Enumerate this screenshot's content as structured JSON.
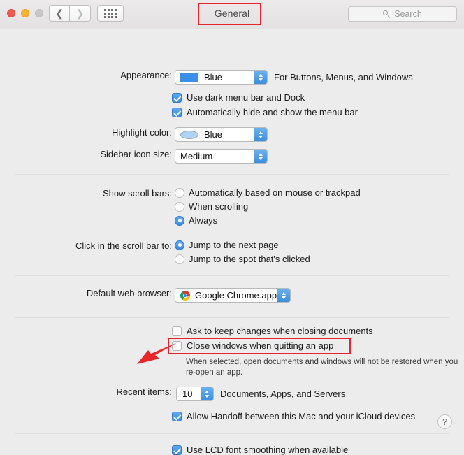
{
  "window": {
    "title": "General",
    "traffic_lights": [
      "close",
      "minimize",
      "zoom"
    ]
  },
  "toolbar": {
    "back_icon": "chevron-left-icon",
    "forward_icon": "chevron-right-icon",
    "grid_icon": "show-all-grid-icon",
    "search": {
      "placeholder": "Search",
      "icon": "search-icon"
    }
  },
  "settings": {
    "appearance": {
      "label": "Appearance:",
      "value": "Blue",
      "swatch_color": "#3b8fe8",
      "trailing_text": "For Buttons, Menus, and Windows"
    },
    "dark_menu_bar": {
      "label": "Use dark menu bar and Dock",
      "checked": true
    },
    "auto_hide_menu_bar": {
      "label": "Automatically hide and show the menu bar",
      "checked": true
    },
    "highlight_color": {
      "label": "Highlight color:",
      "value": "Blue",
      "swatch_color": "#aed3f7"
    },
    "sidebar_icon_size": {
      "label": "Sidebar icon size:",
      "value": "Medium"
    },
    "show_scroll_bars": {
      "label": "Show scroll bars:",
      "options": [
        {
          "label": "Automatically based on mouse or trackpad",
          "selected": false
        },
        {
          "label": "When scrolling",
          "selected": false
        },
        {
          "label": "Always",
          "selected": true
        }
      ]
    },
    "click_scroll_bar": {
      "label": "Click in the scroll bar to:",
      "options": [
        {
          "label": "Jump to the next page",
          "selected": true
        },
        {
          "label": "Jump to the spot that's clicked",
          "selected": false
        }
      ]
    },
    "default_web_browser": {
      "label": "Default web browser:",
      "value": "Google Chrome.app",
      "icon": "chrome-icon"
    },
    "ask_keep_changes": {
      "label": "Ask to keep changes when closing documents",
      "checked": false
    },
    "close_windows_quitting": {
      "label": "Close windows when quitting an app",
      "checked": false,
      "hint": "When selected, open documents and windows will not be restored when you re-open an app.",
      "annotated": true
    },
    "recent_items": {
      "label": "Recent items:",
      "value": "10",
      "trailing_text": "Documents, Apps, and Servers"
    },
    "handoff": {
      "label": "Allow Handoff between this Mac and your iCloud devices",
      "checked": true
    },
    "lcd_font_smoothing": {
      "label": "Use LCD font smoothing when available",
      "checked": true
    }
  },
  "help": {
    "label": "?"
  },
  "annotation": {
    "color": "#e8262a"
  }
}
